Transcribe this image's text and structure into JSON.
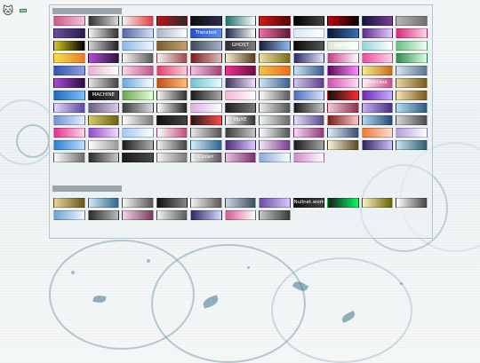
{
  "header": {
    "cat_icon": "cat-icon",
    "sign_text": "(no visible text)"
  },
  "sections": [
    {
      "label": "",
      "buttons": [
        {
          "text": "",
          "c1": "#cf5b8b",
          "c2": "#f7c0dc"
        },
        {
          "text": "",
          "c1": "#333333",
          "c2": "#d8d8d8"
        },
        {
          "text": "",
          "c1": "#f3f3f3",
          "c2": "#e43c3c"
        },
        {
          "text": "",
          "c1": "#c41313",
          "c2": "#2b2b2b"
        },
        {
          "text": "",
          "c1": "#0c0c0c",
          "c2": "#2f2f4f"
        },
        {
          "text": "",
          "c1": "#1f6f69",
          "c2": "#ffffff"
        },
        {
          "text": "",
          "c1": "#d11a1a",
          "c2": "#5a0000"
        },
        {
          "text": "",
          "c1": "#000000",
          "c2": "#444444"
        },
        {
          "text": "",
          "c1": "#c50010",
          "c2": "#000000"
        },
        {
          "text": "",
          "c1": "#17153a",
          "c2": "#7a3d99"
        },
        {
          "text": "",
          "c1": "#b5b5b5",
          "c2": "#707070"
        },
        {
          "text": "",
          "c1": "#6b4c9a",
          "c2": "#2b1d4a"
        },
        {
          "text": "",
          "c1": "#f5f5f5",
          "c2": "#333333"
        },
        {
          "text": "",
          "c1": "#5167a8",
          "c2": "#d7dff7"
        },
        {
          "text": "",
          "c1": "#a8b6c9",
          "c2": "#ffffff"
        },
        {
          "text": "Transbot",
          "c1": "#2a50c8",
          "c2": "#5c8ef0"
        },
        {
          "text": "",
          "c1": "#1b2d4d",
          "c2": "#ffffff"
        },
        {
          "text": "",
          "c1": "#ef6fa6",
          "c2": "#5a1a35"
        },
        {
          "text": "",
          "c1": "#d7e9f6",
          "c2": "#ffffff"
        },
        {
          "text": "",
          "c1": "#0c1833",
          "c2": "#3b6fb3"
        },
        {
          "text": "",
          "c1": "#5a2f8c",
          "c2": "#e5c8ff"
        },
        {
          "text": "",
          "c1": "#d82b79",
          "c2": "#ffd4e6"
        },
        {
          "text": "",
          "c1": "#d7c71e",
          "c2": "#000000"
        },
        {
          "text": "",
          "c1": "#d3d3d3",
          "c2": "#222222"
        },
        {
          "text": "",
          "c1": "#8ab6e8",
          "c2": "#f0f8ff"
        },
        {
          "text": "",
          "c1": "#7a5f31",
          "c2": "#c4a070"
        },
        {
          "text": "",
          "c1": "#3e4b5e",
          "c2": "#a3b3c9"
        },
        {
          "text": "GHOST",
          "c1": "#2d2d2d",
          "c2": "#7d7d7d"
        },
        {
          "text": "",
          "c1": "#1c1c3a",
          "c2": "#8dbcf2"
        },
        {
          "text": "",
          "c1": "#0a0a0a",
          "c2": "#555555"
        },
        {
          "text": "@karoll",
          "c1": "#dcecd3",
          "c2": "#ffffff"
        },
        {
          "text": "",
          "c1": "#94d6de",
          "c2": "#ffffff"
        },
        {
          "text": "",
          "c1": "#6bbf82",
          "c2": "#f2fff5"
        },
        {
          "text": "",
          "c1": "#f1e44b",
          "c2": "#ed7b27"
        },
        {
          "text": "",
          "c1": "#b24ecf",
          "c2": "#2f1342"
        },
        {
          "text": "",
          "c1": "#f9f9f9",
          "c2": "#5a5a5a"
        },
        {
          "text": "",
          "c1": "#f4f4f4",
          "c2": "#a14949"
        },
        {
          "text": "",
          "c1": "#7a1e1e",
          "c2": "#e2bcbc"
        },
        {
          "text": "",
          "c1": "#f4ecd4",
          "c2": "#5a3d1a"
        },
        {
          "text": "",
          "c1": "#e8e1a4",
          "c2": "#7d6b1a"
        },
        {
          "text": "",
          "c1": "#2d2d6b",
          "c2": "#e1e1ff"
        },
        {
          "text": "",
          "c1": "#c83a8a",
          "c2": "#ffffff"
        },
        {
          "text": "",
          "c1": "#e84da0",
          "c2": "#ffd1ea"
        },
        {
          "text": "",
          "c1": "#2f8e4d",
          "c2": "#d9ffe6"
        },
        {
          "text": "",
          "c1": "#3355aa",
          "c2": "#8f9ee4"
        },
        {
          "text": "",
          "c1": "#e8b2d1",
          "c2": "#ffffff"
        },
        {
          "text": "",
          "c1": "#f5d7e6",
          "c2": "#c2588d"
        },
        {
          "text": "",
          "c1": "#e83c6e",
          "c2": "#ffd1df"
        },
        {
          "text": "",
          "c1": "#f2c5e2",
          "c2": "#a34079"
        },
        {
          "text": "",
          "c1": "#ef2f8f",
          "c2": "#6f0f3d"
        },
        {
          "text": "",
          "c1": "#efc44b",
          "c2": "#f26b1d"
        },
        {
          "text": "",
          "c1": "#cfe1f5",
          "c2": "#3b5d90"
        },
        {
          "text": "",
          "c1": "#5a0a5a",
          "c2": "#ff8cff"
        },
        {
          "text": "",
          "c1": "#f2ec8f",
          "c2": "#c76b1d"
        },
        {
          "text": "",
          "c1": "#d7e5ef",
          "c2": "#5a7790"
        },
        {
          "text": "",
          "c1": "#a94be0",
          "c2": "#2a0d40"
        },
        {
          "text": "",
          "c1": "#e5e5e5",
          "c2": "#444444"
        },
        {
          "text": "",
          "c1": "#6ba6e3",
          "c2": "#ffffff"
        },
        {
          "text": "",
          "c1": "#c24e18",
          "c2": "#ffbe7d"
        },
        {
          "text": "",
          "c1": "#70c5d1",
          "c2": "#e9fbff"
        },
        {
          "text": "",
          "c1": "#41345c",
          "c2": "#f1e1ff"
        },
        {
          "text": "",
          "c1": "#d3e7f7",
          "c2": "#3a608f"
        },
        {
          "text": "",
          "c1": "#d2c7ec",
          "c2": "#5a3f8f"
        },
        {
          "text": "",
          "c1": "#d64bb0",
          "c2": "#ffe0f5"
        },
        {
          "text": "Princess",
          "c1": "#fff2f8",
          "c2": "#c54d8d"
        },
        {
          "text": "",
          "c1": "#e7d5a5",
          "c2": "#7a5c1f"
        },
        {
          "text": "",
          "c1": "#1c6bb8",
          "c2": "#7fc0ff"
        },
        {
          "text": "MACHINE",
          "c1": "#111111",
          "c2": "#444444"
        },
        {
          "text": "",
          "c1": "#6ba653",
          "c2": "#e7ffdd"
        },
        {
          "text": "",
          "c1": "#f5f5f5",
          "c2": "#333333"
        },
        {
          "text": "",
          "c1": "#1b1b1b",
          "c2": "#a7a7a7"
        },
        {
          "text": "",
          "c1": "#f1b6d6",
          "c2": "#ffffff"
        },
        {
          "text": "",
          "c1": "#ffffff",
          "c2": "#5c5c5c"
        },
        {
          "text": "",
          "c1": "#4c6fb8",
          "c2": "#dbe6ff"
        },
        {
          "text": "",
          "c1": "#111111",
          "c2": "#ff2a2a"
        },
        {
          "text": "",
          "c1": "#6a2eb7",
          "c2": "#c8aaff"
        },
        {
          "text": "",
          "c1": "#f4e4b5",
          "c2": "#7a5c1f"
        },
        {
          "text": "",
          "c1": "#e0d8f5",
          "c2": "#5a4a9f"
        },
        {
          "text": "",
          "c1": "#6b5f82",
          "c2": "#d6cbe8"
        },
        {
          "text": "",
          "c1": "#3d3b3b",
          "c2": "#dedede"
        },
        {
          "text": "",
          "c1": "#ffffff",
          "c2": "#222222"
        },
        {
          "text": "",
          "c1": "#d7b1e0",
          "c2": "#ffffff"
        },
        {
          "text": "",
          "c1": "#1f1f1f",
          "c2": "#7a7a7a"
        },
        {
          "text": "",
          "c1": "#ededed",
          "c2": "#555555"
        },
        {
          "text": "",
          "c1": "#191919",
          "c2": "#c4c4c4"
        },
        {
          "text": "",
          "c1": "#f6ccd9",
          "c2": "#8d2f4d"
        },
        {
          "text": "",
          "c1": "#c7b0f0",
          "c2": "#4a2e8a"
        },
        {
          "text": "",
          "c1": "#b9dcf3",
          "c2": "#2a5a80"
        },
        {
          "text": "",
          "c1": "#6e94d6",
          "c2": "#e5efff"
        },
        {
          "text": "",
          "c1": "#d6cd6d",
          "c2": "#6b5f15"
        },
        {
          "text": "",
          "c1": "#ffffff",
          "c2": "#7a7a7a"
        },
        {
          "text": "",
          "c1": "#111111",
          "c2": "#444444"
        },
        {
          "text": "",
          "c1": "#1b1b1b",
          "c2": "#ff4b4b"
        },
        {
          "text": "tfpXE",
          "c1": "#f4f4f4",
          "c2": "#333333"
        },
        {
          "text": "",
          "c1": "#f4f4f4",
          "c2": "#6b6b6b"
        },
        {
          "text": "",
          "c1": "#e8e0f3",
          "c2": "#5a4a8f"
        },
        {
          "text": "",
          "c1": "#7d1d1d",
          "c2": "#ffc6c6"
        },
        {
          "text": "",
          "c1": "#b5d5ef",
          "c2": "#234c74"
        },
        {
          "text": "",
          "c1": "#d9d9d9",
          "c2": "#4a4a4a"
        },
        {
          "text": "",
          "c1": "#e62e8f",
          "c2": "#ffd4eb"
        },
        {
          "text": "",
          "c1": "#8f4bc9",
          "c2": "#f0deff"
        },
        {
          "text": "",
          "c1": "#a3c8f5",
          "c2": "#ffffff"
        },
        {
          "text": "",
          "c1": "#ffffff",
          "c2": "#c44b7a"
        },
        {
          "text": "",
          "c1": "#e9e9e9",
          "c2": "#555555"
        },
        {
          "text": "",
          "c1": "#3d3d3d",
          "c2": "#c7c7c7"
        },
        {
          "text": "",
          "c1": "#ffffff",
          "c2": "#555555"
        },
        {
          "text": "",
          "c1": "#f7d8f0",
          "c2": "#933a7a"
        },
        {
          "text": "",
          "c1": "#e6ecf5",
          "c2": "#3a4d70"
        },
        {
          "text": "",
          "c1": "#f07a3a",
          "c2": "#ffe0cf"
        },
        {
          "text": "",
          "c1": "#b39ddb",
          "c2": "#ffffff"
        },
        {
          "text": "",
          "c1": "#2a7fd4",
          "c2": "#bfe0ff"
        },
        {
          "text": "",
          "c1": "#ffffff",
          "c2": "#9a9a9a"
        },
        {
          "text": "",
          "c1": "#1b1b1b",
          "c2": "#b0b0b0"
        },
        {
          "text": "",
          "c1": "#f2f2f2",
          "c2": "#444444"
        },
        {
          "text": "",
          "c1": "#d8eefb",
          "c2": "#2a648f"
        },
        {
          "text": "",
          "c1": "#4c2a7a",
          "c2": "#e0c8ff"
        },
        {
          "text": "",
          "c1": "#f3e7f7",
          "c2": "#7a3a8f"
        },
        {
          "text": "",
          "c1": "#1b1b1b",
          "c2": "#a7a7a7"
        },
        {
          "text": "",
          "c1": "#f7f2e0",
          "c2": "#5a4a1f"
        },
        {
          "text": "",
          "c1": "#30255a",
          "c2": "#d0c0ff"
        },
        {
          "text": "",
          "c1": "#c9e3ef",
          "c2": "#2f5f73"
        },
        {
          "text": "",
          "c1": "#ffffff",
          "c2": "#6a6a6a"
        },
        {
          "text": "",
          "c1": "#2b2b2b",
          "c2": "#c9c9c9"
        },
        {
          "text": "",
          "c1": "#1a1a1a",
          "c2": "#4b4b4b"
        },
        {
          "text": "",
          "c1": "#f2f2f2",
          "c2": "#7a7a7a"
        },
        {
          "text": "Cezarr",
          "c1": "#f4f4f4",
          "c2": "#5a5a5a"
        },
        {
          "text": "",
          "c1": "#e9c2e1",
          "c2": "#7a2f6b"
        },
        {
          "text": "",
          "c1": "#8aa9d6",
          "c2": "#ffffff"
        },
        {
          "text": "",
          "c1": "#d28ac8",
          "c2": "#ffffff"
        }
      ]
    },
    {
      "label": "",
      "buttons": [
        {
          "text": "",
          "c1": "#e7d59a",
          "c2": "#6b5419"
        },
        {
          "text": "",
          "c1": "#d1e8f6",
          "c2": "#2f6a8f"
        },
        {
          "text": "",
          "c1": "#f7f7f7",
          "c2": "#555555"
        },
        {
          "text": "",
          "c1": "#111111",
          "c2": "#888888"
        },
        {
          "text": "",
          "c1": "#f2f2f2",
          "c2": "#5a5a5a"
        },
        {
          "text": "",
          "c1": "#c9d6e1",
          "c2": "#3a4f5f"
        },
        {
          "text": "",
          "c1": "#6b4ba8",
          "c2": "#d8c8ff"
        },
        {
          "text": "Nullnet.work",
          "c1": "#111111",
          "c2": "#444444"
        },
        {
          "text": "",
          "c1": "#1a1a1a",
          "c2": "#00ff66"
        },
        {
          "text": "",
          "c1": "#f7f2c0",
          "c2": "#6b6200"
        },
        {
          "text": "",
          "c1": "#ffffff",
          "c2": "#444444"
        },
        {
          "text": "",
          "c1": "#6aa3d6",
          "c2": "#f0f8ff"
        },
        {
          "text": "",
          "c1": "#2d2d2d",
          "c2": "#bababa"
        },
        {
          "text": "",
          "c1": "#f3d6e6",
          "c2": "#7a3a5d"
        },
        {
          "text": "",
          "c1": "#f3f3f3",
          "c2": "#5a5a5a"
        },
        {
          "text": "",
          "c1": "#2a2a6b",
          "c2": "#d7d7ff"
        },
        {
          "text": "",
          "c1": "#d65a8f",
          "c2": "#ffffff"
        },
        {
          "text": "",
          "c1": "#c7c7c7",
          "c2": "#3a3a3a"
        }
      ]
    }
  ]
}
